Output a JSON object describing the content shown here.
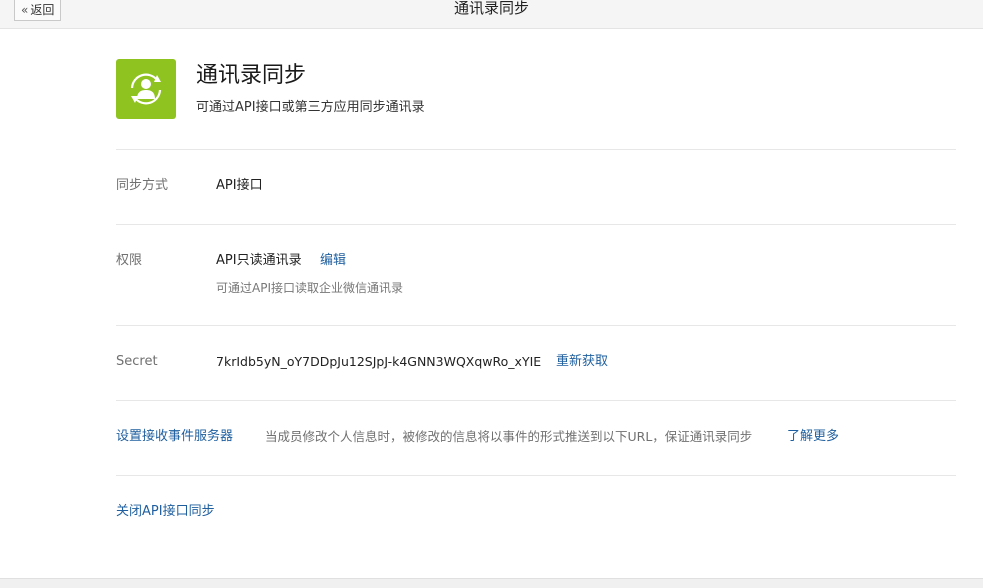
{
  "topbar": {
    "back_label": "返回",
    "title": "通讯录同步"
  },
  "header": {
    "icon": "contacts-sync-icon",
    "icon_color": "#8fc31f",
    "title": "通讯录同步",
    "description": "可通过API接口或第三方应用同步通讯录"
  },
  "sync_method": {
    "label": "同步方式",
    "value": "API接口"
  },
  "permission": {
    "label": "权限",
    "value": "API只读通讯录",
    "edit_link": "编辑",
    "hint": "可通过API接口读取企业微信通讯录"
  },
  "secret": {
    "label": "Secret",
    "value": "7krIdb5yN_oY7DDpJu12SJpJ-k4GNN3WQXqwRo_xYIE",
    "refresh_link": "重新获取"
  },
  "event_server": {
    "link": "设置接收事件服务器",
    "description": "当成员修改个人信息时，被修改的信息将以事件的形式推送到以下URL，保证通讯录同步",
    "learn_more_link": "了解更多"
  },
  "close_sync": {
    "link": "关闭API接口同步"
  },
  "colors": {
    "link": "#1f5f9f",
    "accent_green": "#8fc31f"
  }
}
